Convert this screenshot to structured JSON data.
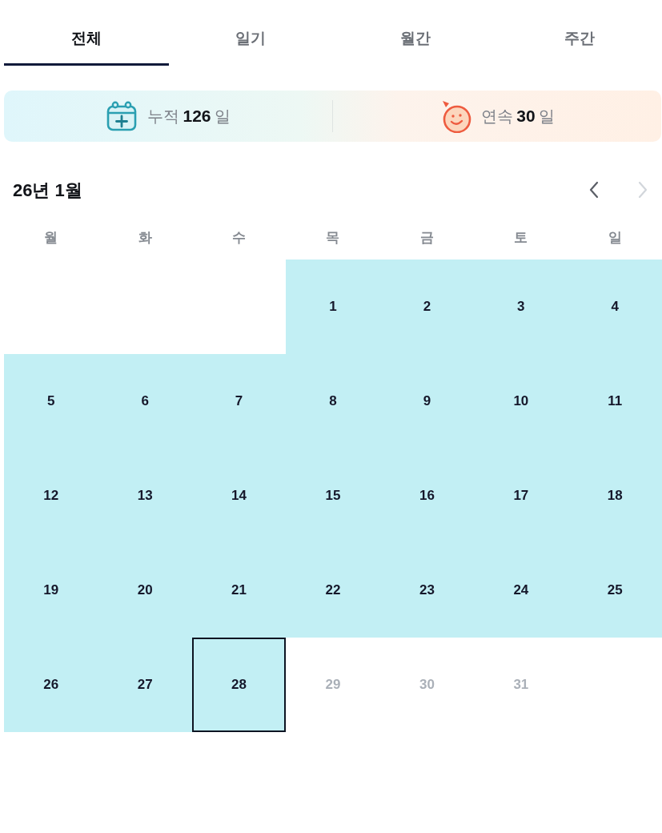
{
  "tabs": [
    {
      "label": "전체",
      "selected": true
    },
    {
      "label": "일기",
      "selected": false
    },
    {
      "label": "월간",
      "selected": false
    },
    {
      "label": "주간",
      "selected": false
    }
  ],
  "stats": [
    {
      "kind": "total",
      "label": "누적",
      "value": "126",
      "unit": "일"
    },
    {
      "kind": "streak",
      "label": "연속",
      "value": "30",
      "unit": "일"
    }
  ],
  "calendar": {
    "title": "26년 1월",
    "nav_buttons": [
      {
        "kind": "prev",
        "disabled": false
      },
      {
        "kind": "next",
        "disabled": true
      }
    ],
    "weekdays": [
      "월",
      "화",
      "수",
      "목",
      "금",
      "토",
      "일"
    ],
    "weeks": [
      {
        "days": [
          {
            "kind": "blank"
          },
          {
            "kind": "blank"
          },
          {
            "kind": "blank"
          },
          {
            "kind": "day",
            "label": "1",
            "recorded": true,
            "today": false,
            "disabled": false
          },
          {
            "kind": "day",
            "label": "2",
            "recorded": true,
            "today": false,
            "disabled": false
          },
          {
            "kind": "day",
            "label": "3",
            "recorded": true,
            "today": false,
            "disabled": false
          },
          {
            "kind": "day",
            "label": "4",
            "recorded": true,
            "today": false,
            "disabled": false
          }
        ]
      },
      {
        "days": [
          {
            "kind": "day",
            "label": "5",
            "recorded": true,
            "today": false,
            "disabled": false
          },
          {
            "kind": "day",
            "label": "6",
            "recorded": true,
            "today": false,
            "disabled": false
          },
          {
            "kind": "day",
            "label": "7",
            "recorded": true,
            "today": false,
            "disabled": false
          },
          {
            "kind": "day",
            "label": "8",
            "recorded": true,
            "today": false,
            "disabled": false
          },
          {
            "kind": "day",
            "label": "9",
            "recorded": true,
            "today": false,
            "disabled": false
          },
          {
            "kind": "day",
            "label": "10",
            "recorded": true,
            "today": false,
            "disabled": false
          },
          {
            "kind": "day",
            "label": "11",
            "recorded": true,
            "today": false,
            "disabled": false
          }
        ]
      },
      {
        "days": [
          {
            "kind": "day",
            "label": "12",
            "recorded": true,
            "today": false,
            "disabled": false
          },
          {
            "kind": "day",
            "label": "13",
            "recorded": true,
            "today": false,
            "disabled": false
          },
          {
            "kind": "day",
            "label": "14",
            "recorded": true,
            "today": false,
            "disabled": false
          },
          {
            "kind": "day",
            "label": "15",
            "recorded": true,
            "today": false,
            "disabled": false
          },
          {
            "kind": "day",
            "label": "16",
            "recorded": true,
            "today": false,
            "disabled": false
          },
          {
            "kind": "day",
            "label": "17",
            "recorded": true,
            "today": false,
            "disabled": false
          },
          {
            "kind": "day",
            "label": "18",
            "recorded": true,
            "today": false,
            "disabled": false
          }
        ]
      },
      {
        "days": [
          {
            "kind": "day",
            "label": "19",
            "recorded": true,
            "today": false,
            "disabled": false
          },
          {
            "kind": "day",
            "label": "20",
            "recorded": true,
            "today": false,
            "disabled": false
          },
          {
            "kind": "day",
            "label": "21",
            "recorded": true,
            "today": false,
            "disabled": false
          },
          {
            "kind": "day",
            "label": "22",
            "recorded": true,
            "today": false,
            "disabled": false
          },
          {
            "kind": "day",
            "label": "23",
            "recorded": true,
            "today": false,
            "disabled": false
          },
          {
            "kind": "day",
            "label": "24",
            "recorded": true,
            "today": false,
            "disabled": false
          },
          {
            "kind": "day",
            "label": "25",
            "recorded": true,
            "today": false,
            "disabled": false
          }
        ]
      },
      {
        "days": [
          {
            "kind": "day",
            "label": "26",
            "recorded": true,
            "today": false,
            "disabled": false
          },
          {
            "kind": "day",
            "label": "27",
            "recorded": true,
            "today": false,
            "disabled": false
          },
          {
            "kind": "day",
            "label": "28",
            "recorded": true,
            "today": true,
            "disabled": false
          },
          {
            "kind": "day",
            "label": "29",
            "recorded": false,
            "today": false,
            "disabled": true
          },
          {
            "kind": "day",
            "label": "30",
            "recorded": false,
            "today": false,
            "disabled": true
          },
          {
            "kind": "day",
            "label": "31",
            "recorded": false,
            "today": false,
            "disabled": true
          },
          {
            "kind": "blank"
          }
        ]
      }
    ]
  }
}
